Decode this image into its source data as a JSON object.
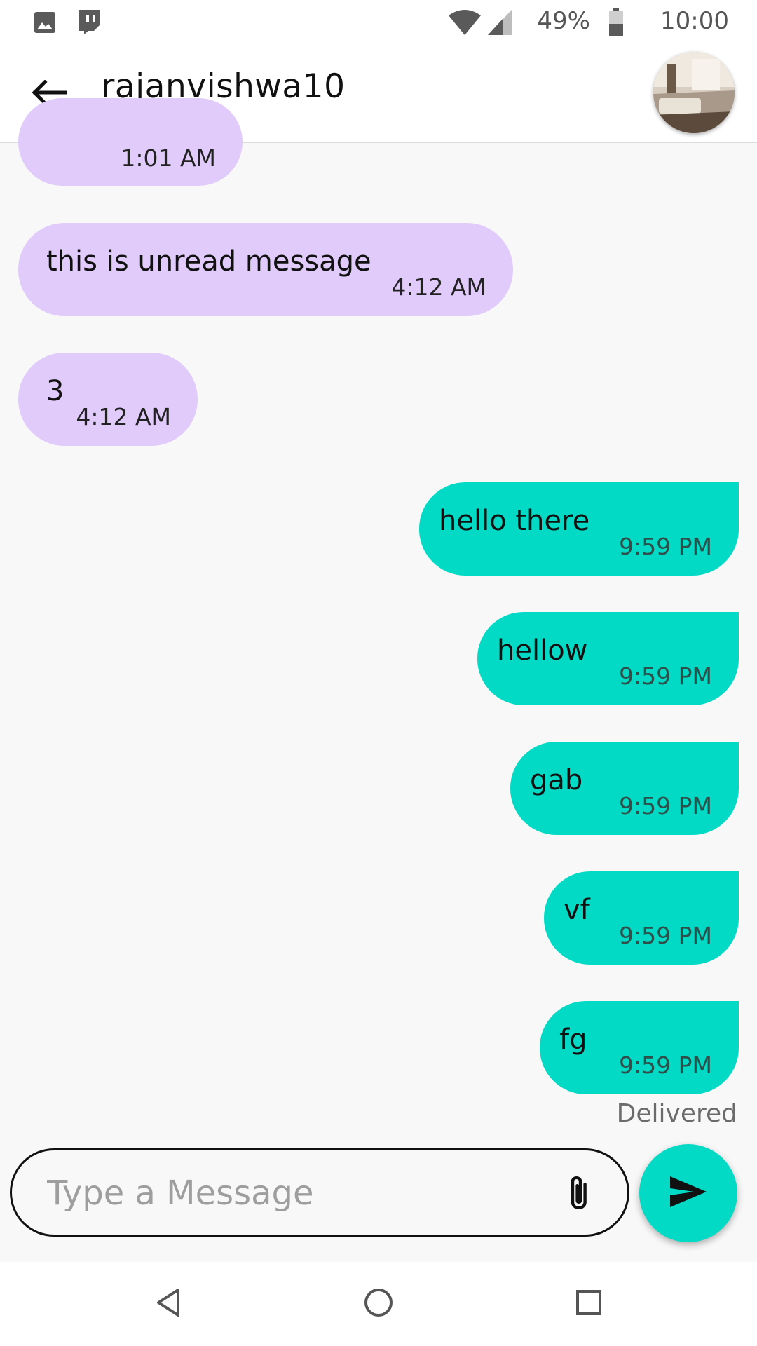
{
  "status_bar": {
    "battery": "49%",
    "time": "10:00",
    "icons": [
      "gallery-icon",
      "twitch-icon",
      "wifi-icon",
      "signal-icon",
      "battery-icon"
    ]
  },
  "header": {
    "back_icon": "arrow-left-icon",
    "title": "rajanvishwa10",
    "avatar_icon": "profile-photo"
  },
  "messages": [
    {
      "direction": "incoming",
      "text": "",
      "time": "1:01 AM"
    },
    {
      "direction": "incoming",
      "text": "this is unread message",
      "time": "4:12 AM"
    },
    {
      "direction": "incoming",
      "text": "3",
      "time": "4:12 AM"
    },
    {
      "direction": "outgoing",
      "text": "hello there",
      "time": "9:59 PM"
    },
    {
      "direction": "outgoing",
      "text": "hellow",
      "time": "9:59 PM"
    },
    {
      "direction": "outgoing",
      "text": "gab",
      "time": "9:59 PM"
    },
    {
      "direction": "outgoing",
      "text": "vf",
      "time": "9:59 PM"
    },
    {
      "direction": "outgoing",
      "text": "fg",
      "time": "9:59 PM"
    }
  ],
  "delivery_status": "Delivered",
  "composer": {
    "placeholder": "Type a Message",
    "value": "",
    "attach_icon": "paperclip-icon",
    "send_icon": "send-icon"
  },
  "colors": {
    "incoming_bubble": "#e1cbfa",
    "outgoing_bubble": "#03dac5",
    "background": "#f8f8f8"
  },
  "nav_bar": {
    "icons": [
      "back-triangle-icon",
      "home-circle-icon",
      "recents-square-icon"
    ]
  }
}
